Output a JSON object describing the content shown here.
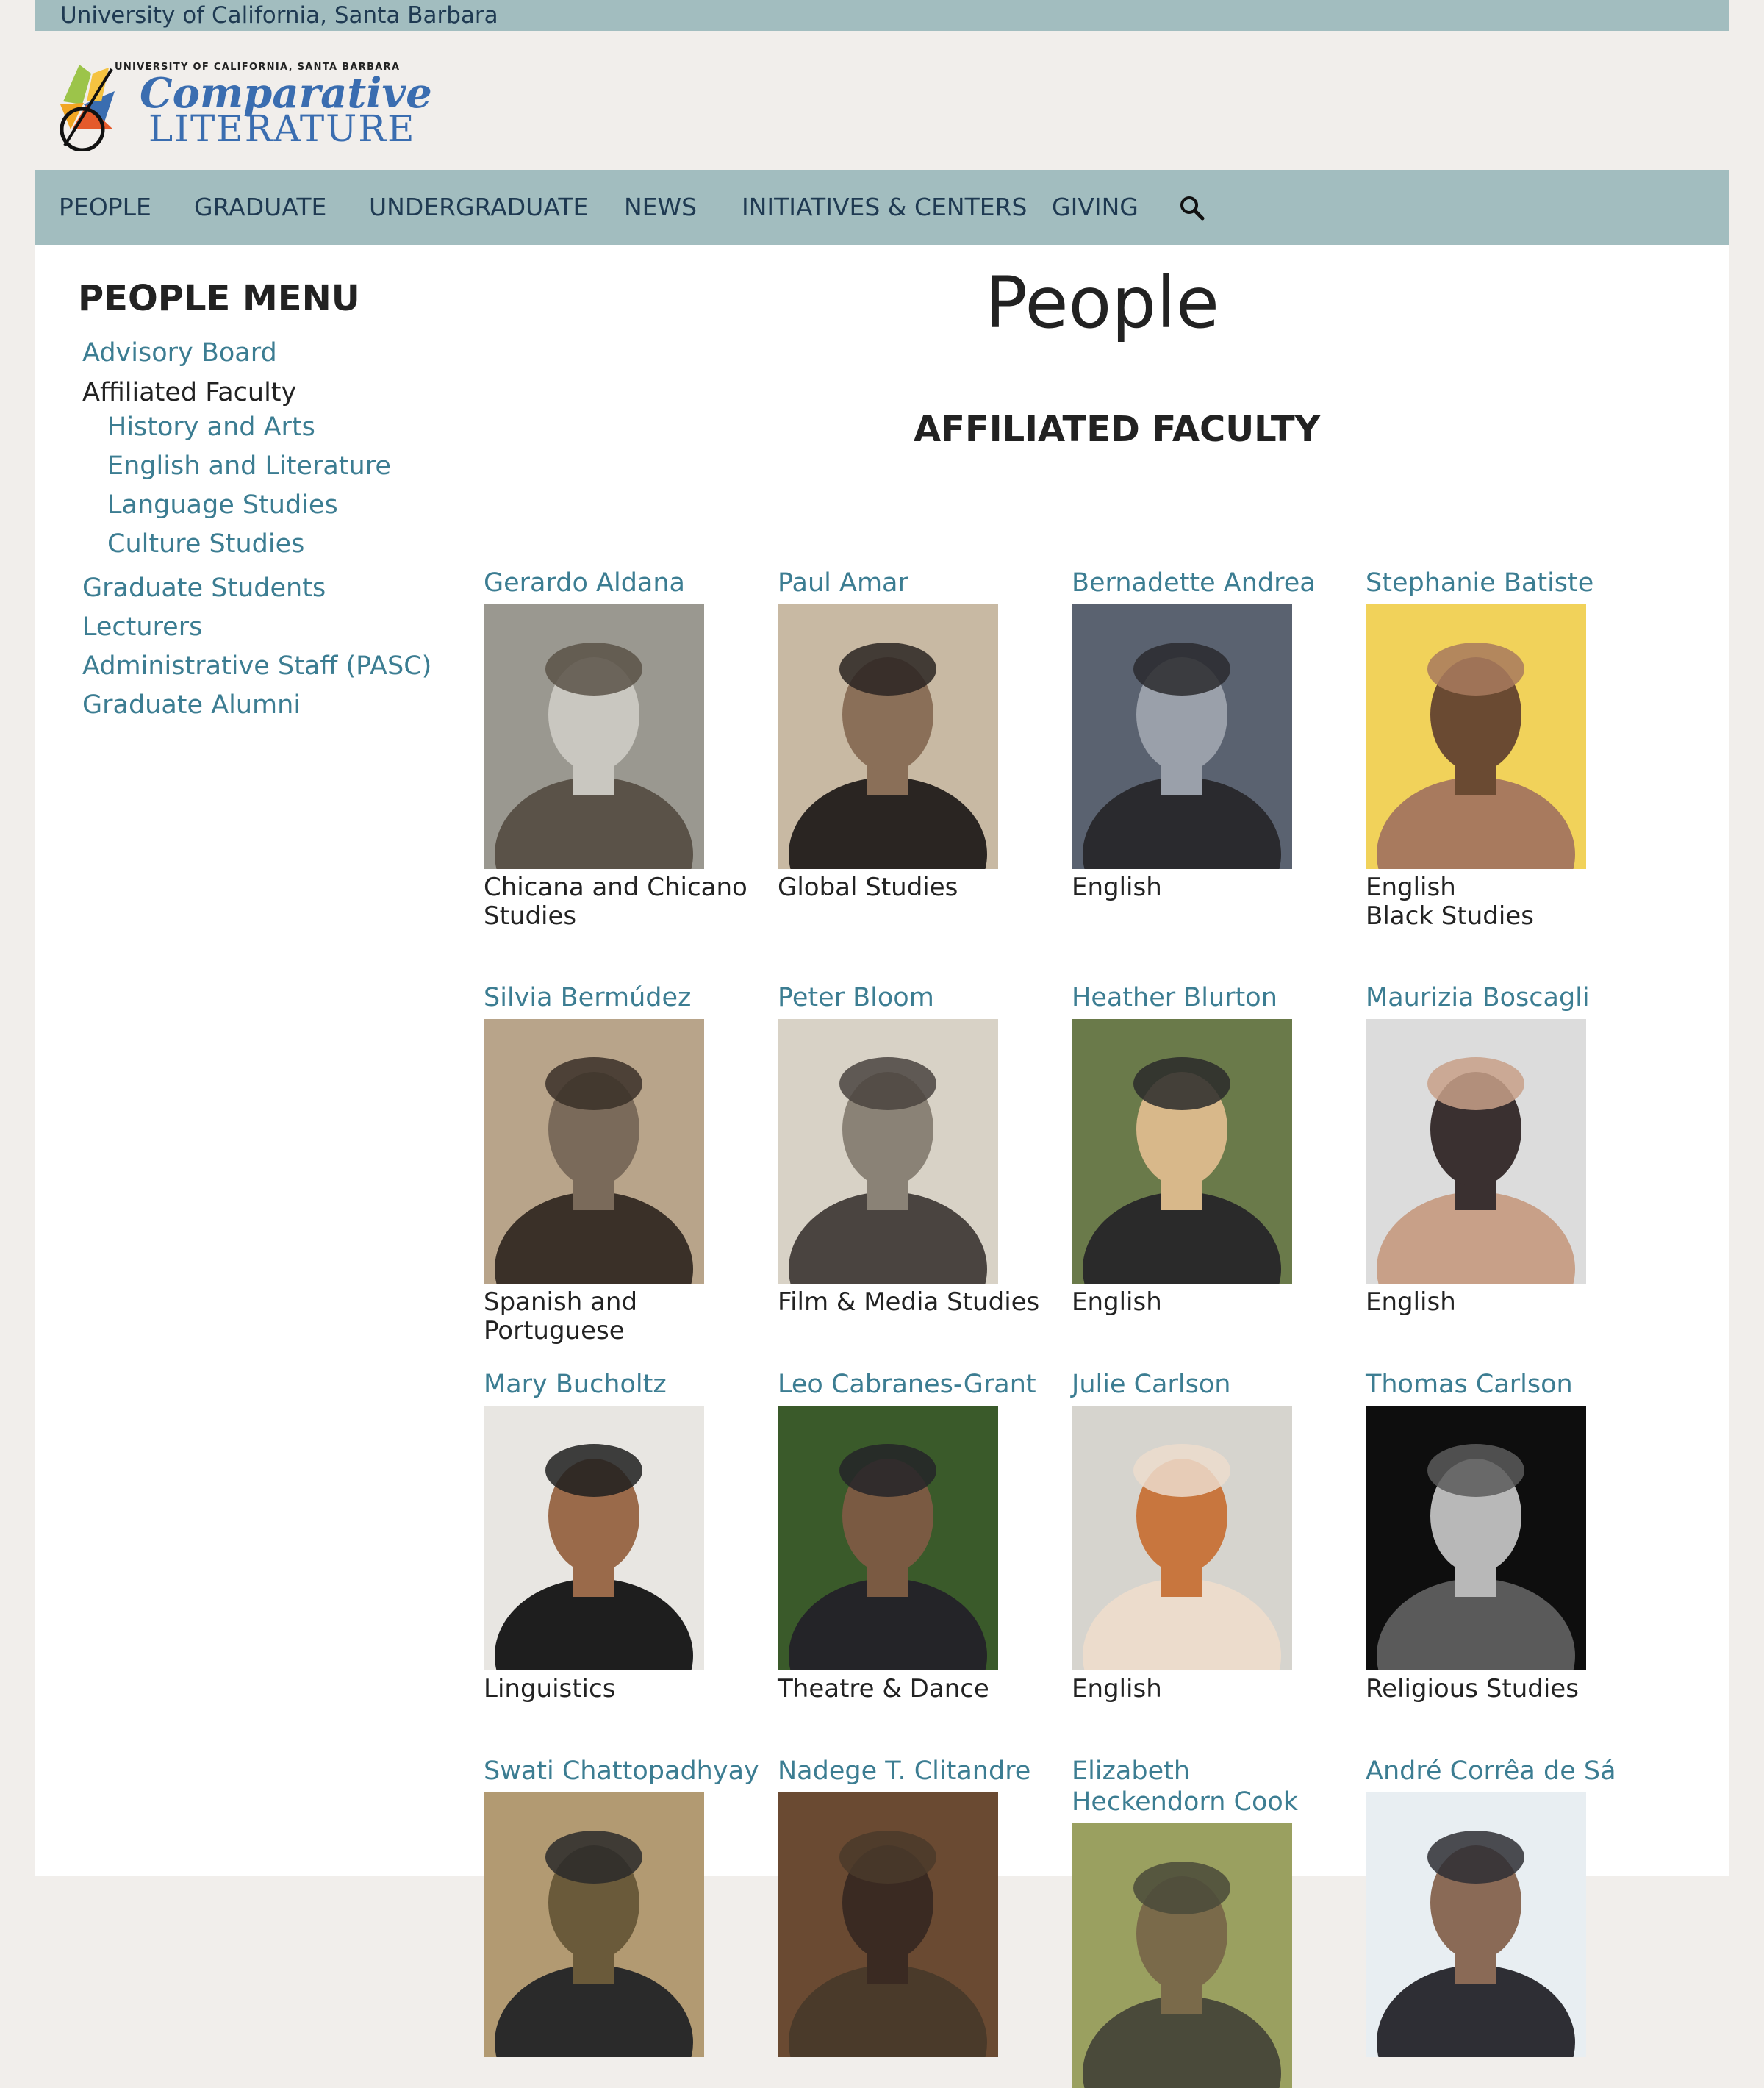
{
  "topbar": {
    "text": "University of California, Santa Barbara"
  },
  "logo": {
    "small": "UNIVERSITY OF CALIFORNIA, SANTA BARBARA",
    "line1": "Comparative",
    "line2": "LITERATURE"
  },
  "nav": {
    "items": [
      "PEOPLE",
      "GRADUATE",
      "UNDERGRADUATE",
      "NEWS",
      "INITIATIVES & CENTERS",
      "GIVING"
    ]
  },
  "sidebar": {
    "title": "PEOPLE MENU",
    "items": [
      "Advisory Board",
      "Affiliated Faculty",
      "History and Arts",
      "English and Literature",
      "Language Studies",
      "Culture Studies",
      "Graduate Students",
      "Lecturers",
      "Administrative Staff (PASC)",
      "Graduate Alumni"
    ]
  },
  "main": {
    "title": "People",
    "section": "AFFILIATED FACULTY",
    "faculty": [
      {
        "name": "Gerardo Aldana",
        "dept": [
          "Chicana and Chicano",
          "Studies"
        ]
      },
      {
        "name": "Paul Amar",
        "dept": [
          "Global Studies"
        ]
      },
      {
        "name": "Bernadette Andrea",
        "dept": [
          "English"
        ]
      },
      {
        "name": "Stephanie Batiste",
        "dept": [
          "English",
          "Black Studies"
        ]
      },
      {
        "name": "Silvia Bermúdez",
        "dept": [
          "Spanish and Portuguese"
        ]
      },
      {
        "name": "Peter Bloom",
        "dept": [
          "Film & Media Studies"
        ]
      },
      {
        "name": "Heather Blurton",
        "dept": [
          "English"
        ]
      },
      {
        "name": "Maurizia Boscagli",
        "dept": [
          "English"
        ]
      },
      {
        "name": "Mary Bucholtz",
        "dept": [
          "Linguistics"
        ]
      },
      {
        "name": "Leo Cabranes-Grant",
        "dept": [
          "Theatre & Dance"
        ]
      },
      {
        "name": "Julie Carlson",
        "dept": [
          "English"
        ]
      },
      {
        "name": "Thomas Carlson",
        "dept": [
          "Religious Studies"
        ]
      },
      {
        "name": "Swati Chattopadhyay",
        "dept": []
      },
      {
        "name": "Nadege T. Clitandre",
        "dept": []
      },
      {
        "name": "Elizabeth Heckendorn Cook",
        "dept": []
      },
      {
        "name": "André Corrêa de Sá",
        "dept": []
      }
    ]
  },
  "colors": {
    "bar": "#a2bdbf",
    "link": "#3c7d92",
    "nav_text": "#1f3a52",
    "page_bg": "#f1eeeb"
  },
  "icons": {
    "search": "search-icon"
  }
}
